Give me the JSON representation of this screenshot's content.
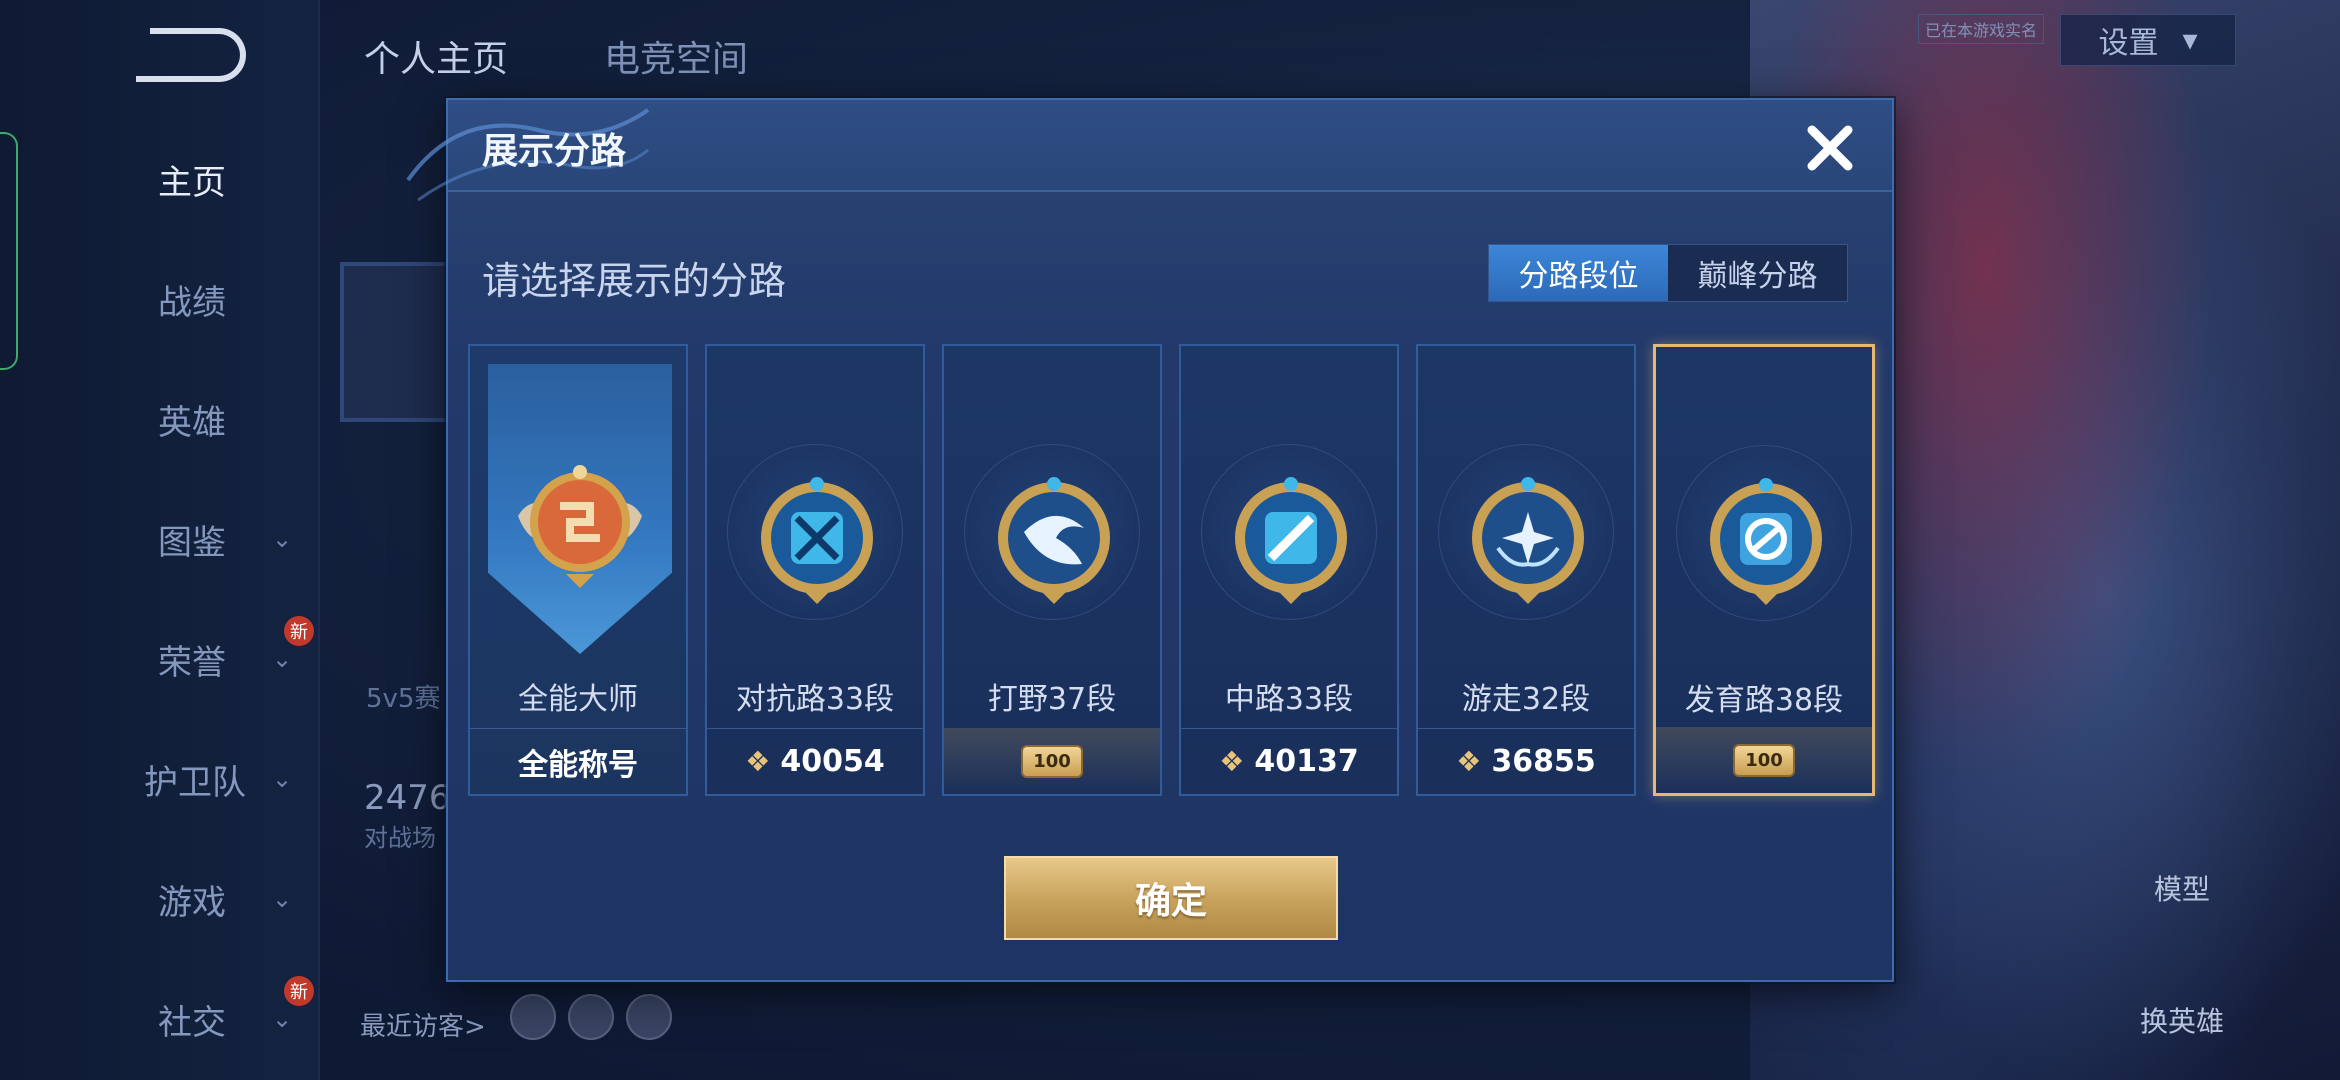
{
  "sidebar": {
    "items": [
      {
        "label": "主页"
      },
      {
        "label": "战绩"
      },
      {
        "label": "英雄"
      },
      {
        "label": "图鉴"
      },
      {
        "label": "荣誉",
        "badge": "新"
      },
      {
        "label": "护卫队"
      },
      {
        "label": "游戏"
      },
      {
        "label": "社交",
        "badge": "新"
      }
    ]
  },
  "header": {
    "tabs": [
      "个人主页",
      "电竞空间"
    ],
    "settings_label": "设置",
    "tag": "已在本游戏实名"
  },
  "background": {
    "mode_text": "5v5赛",
    "count": "2476",
    "count_label": "对战场",
    "recent_visitors": "最近访客>",
    "model_label": "模型",
    "switch_hero_label": "换英雄"
  },
  "modal": {
    "title": "展示分路",
    "subtitle": "请选择展示的分路",
    "segments": [
      "分路段位",
      "巅峰分路"
    ],
    "confirm_label": "确定",
    "cards": [
      {
        "name": "全能大师",
        "footer": "全能称号",
        "type": "title",
        "color": "#d9693a"
      },
      {
        "name": "对抗路33段",
        "footer": "40054",
        "type": "points",
        "color": "#3fb7e8"
      },
      {
        "name": "打野37段",
        "footer": "100",
        "type": "banner",
        "color": "#2f86d8"
      },
      {
        "name": "中路33段",
        "footer": "40137",
        "type": "points",
        "color": "#3fb7e8"
      },
      {
        "name": "游走32段",
        "footer": "36855",
        "type": "points",
        "color": "#2f86d8"
      },
      {
        "name": "发育路38段",
        "footer": "100",
        "type": "banner",
        "color": "#3fa3e0",
        "selected": true
      }
    ]
  }
}
